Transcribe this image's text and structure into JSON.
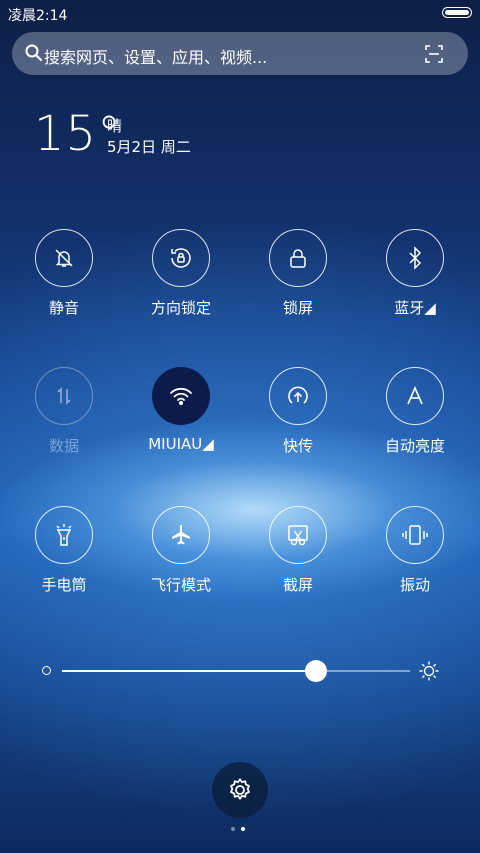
{
  "status_bar": {
    "time": "凌晨2:14"
  },
  "search": {
    "placeholder": "搜索网页、设置、应用、视频..."
  },
  "weather": {
    "temperature": "15°",
    "condition": "晴",
    "date": "5月2日 周二"
  },
  "toggles": [
    {
      "label": "静音",
      "icon": "bell-off-icon",
      "state": "off"
    },
    {
      "label": "方向锁定",
      "icon": "rotation-lock-icon",
      "state": "off"
    },
    {
      "label": "锁屏",
      "icon": "lock-icon",
      "state": "off"
    },
    {
      "label": "蓝牙◢",
      "icon": "bluetooth-icon",
      "state": "off"
    },
    {
      "label": "数据",
      "icon": "mobile-data-icon",
      "state": "disabled"
    },
    {
      "label": "MIUIAU◢",
      "icon": "wifi-icon",
      "state": "on"
    },
    {
      "label": "快传",
      "icon": "quick-transfer-icon",
      "state": "off"
    },
    {
      "label": "自动亮度",
      "icon": "auto-brightness-icon",
      "state": "off"
    },
    {
      "label": "手电筒",
      "icon": "flashlight-icon",
      "state": "off"
    },
    {
      "label": "飞行模式",
      "icon": "airplane-icon",
      "state": "off"
    },
    {
      "label": "截屏",
      "icon": "screenshot-icon",
      "state": "off"
    },
    {
      "label": "振动",
      "icon": "vibrate-icon",
      "state": "off"
    }
  ],
  "brightness": {
    "level": 0.73
  },
  "pager": {
    "total": 2,
    "current": 2
  },
  "colors": {
    "active_toggle": "#0d1b4a",
    "background_top": "#0e1f47",
    "background_mid": "#1b5bb0"
  }
}
